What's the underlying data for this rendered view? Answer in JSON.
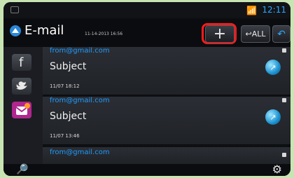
{
  "statusbar": {
    "time": "12:11",
    "wifi_icon": "wifi-icon",
    "mini_icon": "status-indicator-icon"
  },
  "header": {
    "title": "E-mail",
    "timestamp": "11-14-2013 16:56",
    "add_label": "+",
    "all_label": "ALL",
    "back_label": "↶"
  },
  "sidebar": [
    {
      "name": "facebook",
      "icon": "facebook-icon"
    },
    {
      "name": "twitter",
      "icon": "twitter-icon"
    },
    {
      "name": "email",
      "icon": "email-badge-icon"
    }
  ],
  "messages": [
    {
      "from": "from@gmail.com",
      "subject": "Subject",
      "date": "11/07 18:12"
    },
    {
      "from": "from@gmail.com",
      "subject": "Subject",
      "date": "11/07 13:46"
    },
    {
      "from": "from@gmail.com",
      "subject": "",
      "date": ""
    }
  ],
  "bottom": {
    "search_icon": "search-icon",
    "settings_icon": "gear-icon"
  },
  "colors": {
    "accent": "#1e9bff",
    "highlight": "#ff1a1a"
  }
}
